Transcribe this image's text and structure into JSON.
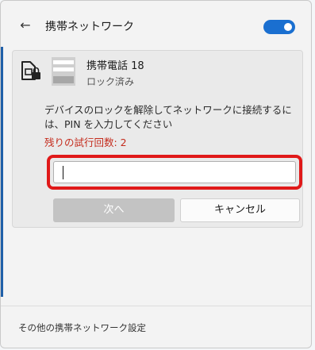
{
  "header": {
    "back_icon": "back-arrow-icon",
    "title": "携帯ネットワーク",
    "toggle_state": "on",
    "accent_color": "#1a6fd0"
  },
  "network": {
    "name": "携帯電話 18",
    "status": "ロック済み",
    "lock_icon": "sim-lock-icon",
    "sim_icon": "sim-card-icon"
  },
  "pin_prompt": {
    "instruction": "デバイスのロックを解除してネットワークに接続するには、PIN を入力してください",
    "attempts_remaining": "残りの試行回数: 2",
    "attempts_color": "#c42b1c",
    "input_value": "",
    "highlight_color": "#e01919"
  },
  "buttons": {
    "next_label": "次へ",
    "cancel_label": "キャンセル"
  },
  "footer": {
    "settings_link": "その他の携帯ネットワーク設定"
  }
}
